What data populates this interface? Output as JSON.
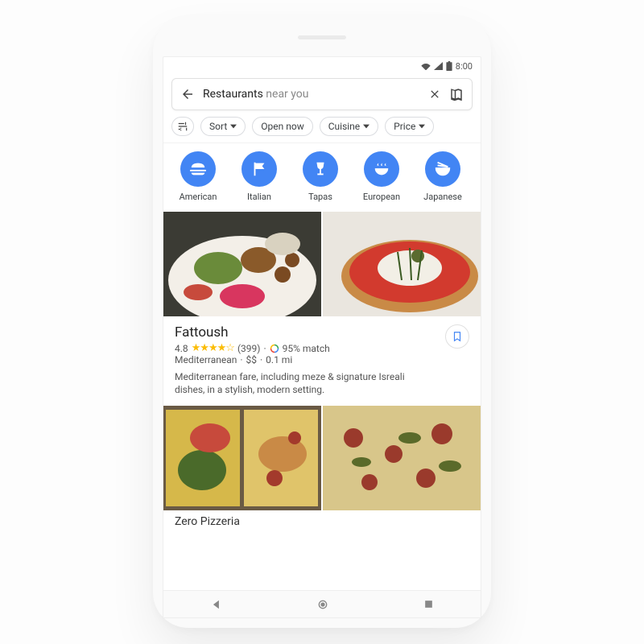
{
  "status": {
    "clock": "8:00"
  },
  "search": {
    "query_main": "Restaurants",
    "query_sub": " near you",
    "back_label": "Back",
    "clear_label": "Clear",
    "map_label": "Map"
  },
  "filters": {
    "tune_label": "Filters",
    "chips": [
      {
        "label": "Sort",
        "caret": true
      },
      {
        "label": "Open now",
        "caret": false
      },
      {
        "label": "Cuisine",
        "caret": true
      },
      {
        "label": "Price",
        "caret": true
      }
    ]
  },
  "categories": [
    {
      "name": "American",
      "icon": "burger"
    },
    {
      "name": "Italian",
      "icon": "flag"
    },
    {
      "name": "Tapas",
      "icon": "wine"
    },
    {
      "name": "European",
      "icon": "bowl"
    },
    {
      "name": "Japanese",
      "icon": "ramen"
    }
  ],
  "results": [
    {
      "name": "Fattoush",
      "rating": "4.8",
      "reviews": "(399)",
      "match": "95% match",
      "cuisine": "Mediterranean",
      "price": "$$",
      "distance": "0.1 mi",
      "desc": "Mediterranean fare, including meze & signature Isreali dishes, in a stylish, modern setting.",
      "stars_glyphs": "★★★★☆",
      "photos": [
        "meze-plate",
        "bruschetta"
      ]
    },
    {
      "name": "Zero Pizzeria",
      "photos": [
        "pizza-tray",
        "pizza-top"
      ]
    }
  ],
  "dot": "·"
}
